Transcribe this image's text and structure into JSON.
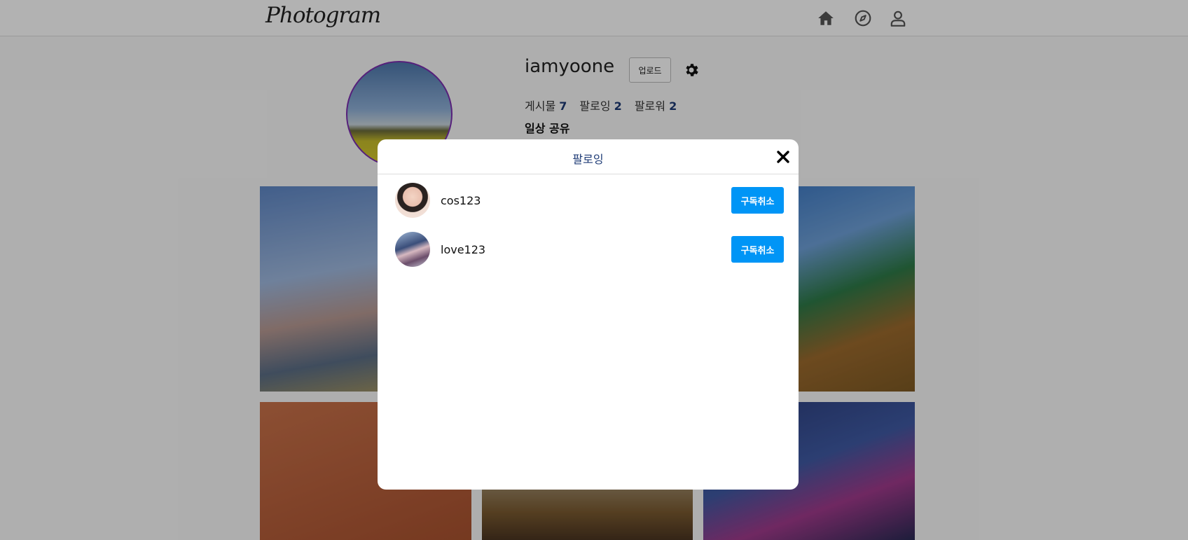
{
  "header": {
    "logo": "Photogram",
    "nav": [
      {
        "name": "home-icon"
      },
      {
        "name": "compass-icon"
      },
      {
        "name": "user-icon"
      }
    ]
  },
  "profile": {
    "username": "iamyoone",
    "upload_label": "업로드",
    "settings_icon": "gear-icon",
    "stats": {
      "posts_label": "게시물",
      "posts_count": "7",
      "following_label": "팔로잉",
      "following_count": "2",
      "followers_label": "팔로워",
      "followers_count": "2"
    },
    "bio": "일상 공유",
    "avatar_border_color": "#7b2fb0"
  },
  "modal": {
    "title": "팔로잉",
    "close_icon": "close-icon",
    "users": [
      {
        "username": "cos123",
        "action_label": "구독취소"
      },
      {
        "username": "love123",
        "action_label": "구독취소"
      }
    ],
    "action_color": "#0095f6"
  }
}
